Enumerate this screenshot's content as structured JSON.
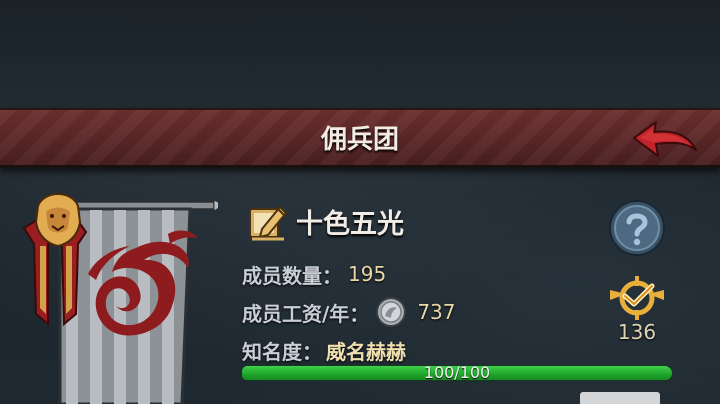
{
  "header": {
    "title": "佣兵团",
    "back_icon": "back-arrow-icon"
  },
  "guild": {
    "name": "十色五光",
    "edit_icon": "edit-pencil-icon",
    "members_label": "成员数量：",
    "members_value": "195",
    "salary_label": "成员工资/年：",
    "salary_value": "737",
    "salary_icon": "silver-coin-icon",
    "fame_label": "知名度：",
    "fame_value": "威名赫赫",
    "fame_progress": {
      "current": 100,
      "max": 100,
      "text": "100/100"
    }
  },
  "side": {
    "help_icon": "question-icon",
    "rank_icon": "rank-badge-icon",
    "rank_count": "136"
  },
  "colors": {
    "title_bar": "#5a2627",
    "accent_gold": "#e8b03a",
    "progress_green": "#2bbb36",
    "back_arrow": "#c0232a"
  }
}
